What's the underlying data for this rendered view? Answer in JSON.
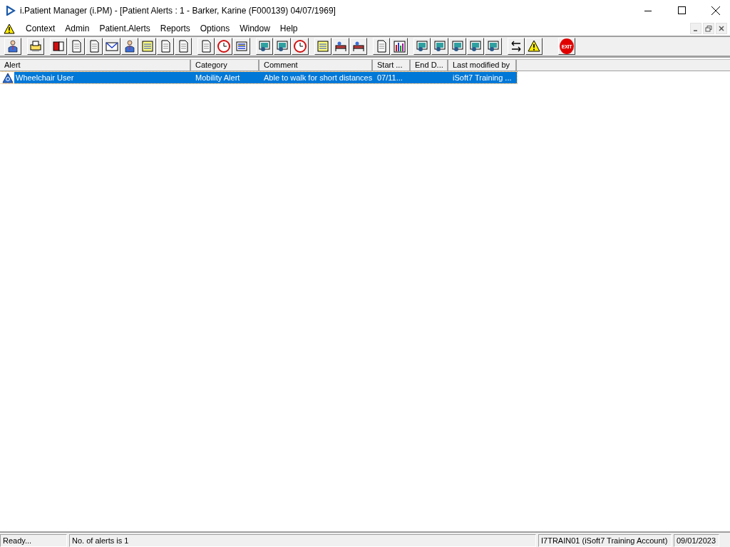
{
  "window": {
    "title": "i.Patient Manager (i.PM) - [Patient Alerts : 1 - Barker, Karine (F000139) 04/07/1969]"
  },
  "menu": [
    "Context",
    "Admin",
    "Patient.Alerts",
    "Reports",
    "Options",
    "Window",
    "Help"
  ],
  "toolbar": {
    "exit_label": "EXIT"
  },
  "table": {
    "columns": [
      "Alert",
      "Category",
      "Comment",
      "Start ...",
      "End D...",
      "Last modified by"
    ],
    "rows": [
      {
        "selected": true,
        "cells": [
          "Wheelchair User",
          "Mobility Alert",
          "Able to walk for short distances",
          "07/11...",
          "",
          "iSoft7 Training ..."
        ]
      }
    ]
  },
  "status_bar": [
    "Ready...",
    "No. of alerts is 1",
    "I7TRAIN01 (iSoft7 Training Account)",
    "09/01/2023"
  ]
}
